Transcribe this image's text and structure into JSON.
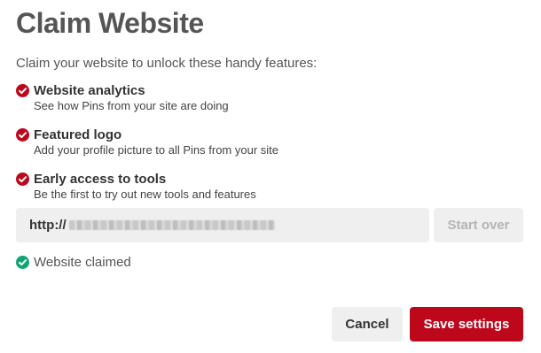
{
  "dialog": {
    "title": "Claim Website",
    "intro": "Claim your website to unlock these handy features:"
  },
  "features": [
    {
      "name": "Website analytics",
      "description": "See how Pins from your site are doing",
      "icon": "check-circle-icon"
    },
    {
      "name": "Featured logo",
      "description": "Add your profile picture to all Pins from your site",
      "icon": "check-circle-icon"
    },
    {
      "name": "Early access to tools",
      "description": "Be the first to try out new tools and features",
      "icon": "check-circle-icon"
    }
  ],
  "url_field": {
    "prefix": "http://"
  },
  "start_over_label": "Start over",
  "status": {
    "text": "Website claimed",
    "icon": "check-circle-icon"
  },
  "actions": {
    "cancel_label": "Cancel",
    "save_label": "Save settings"
  },
  "colors": {
    "brand_red": "#bd081c",
    "success_green": "#0fa573",
    "button_gray": "#efefef"
  }
}
